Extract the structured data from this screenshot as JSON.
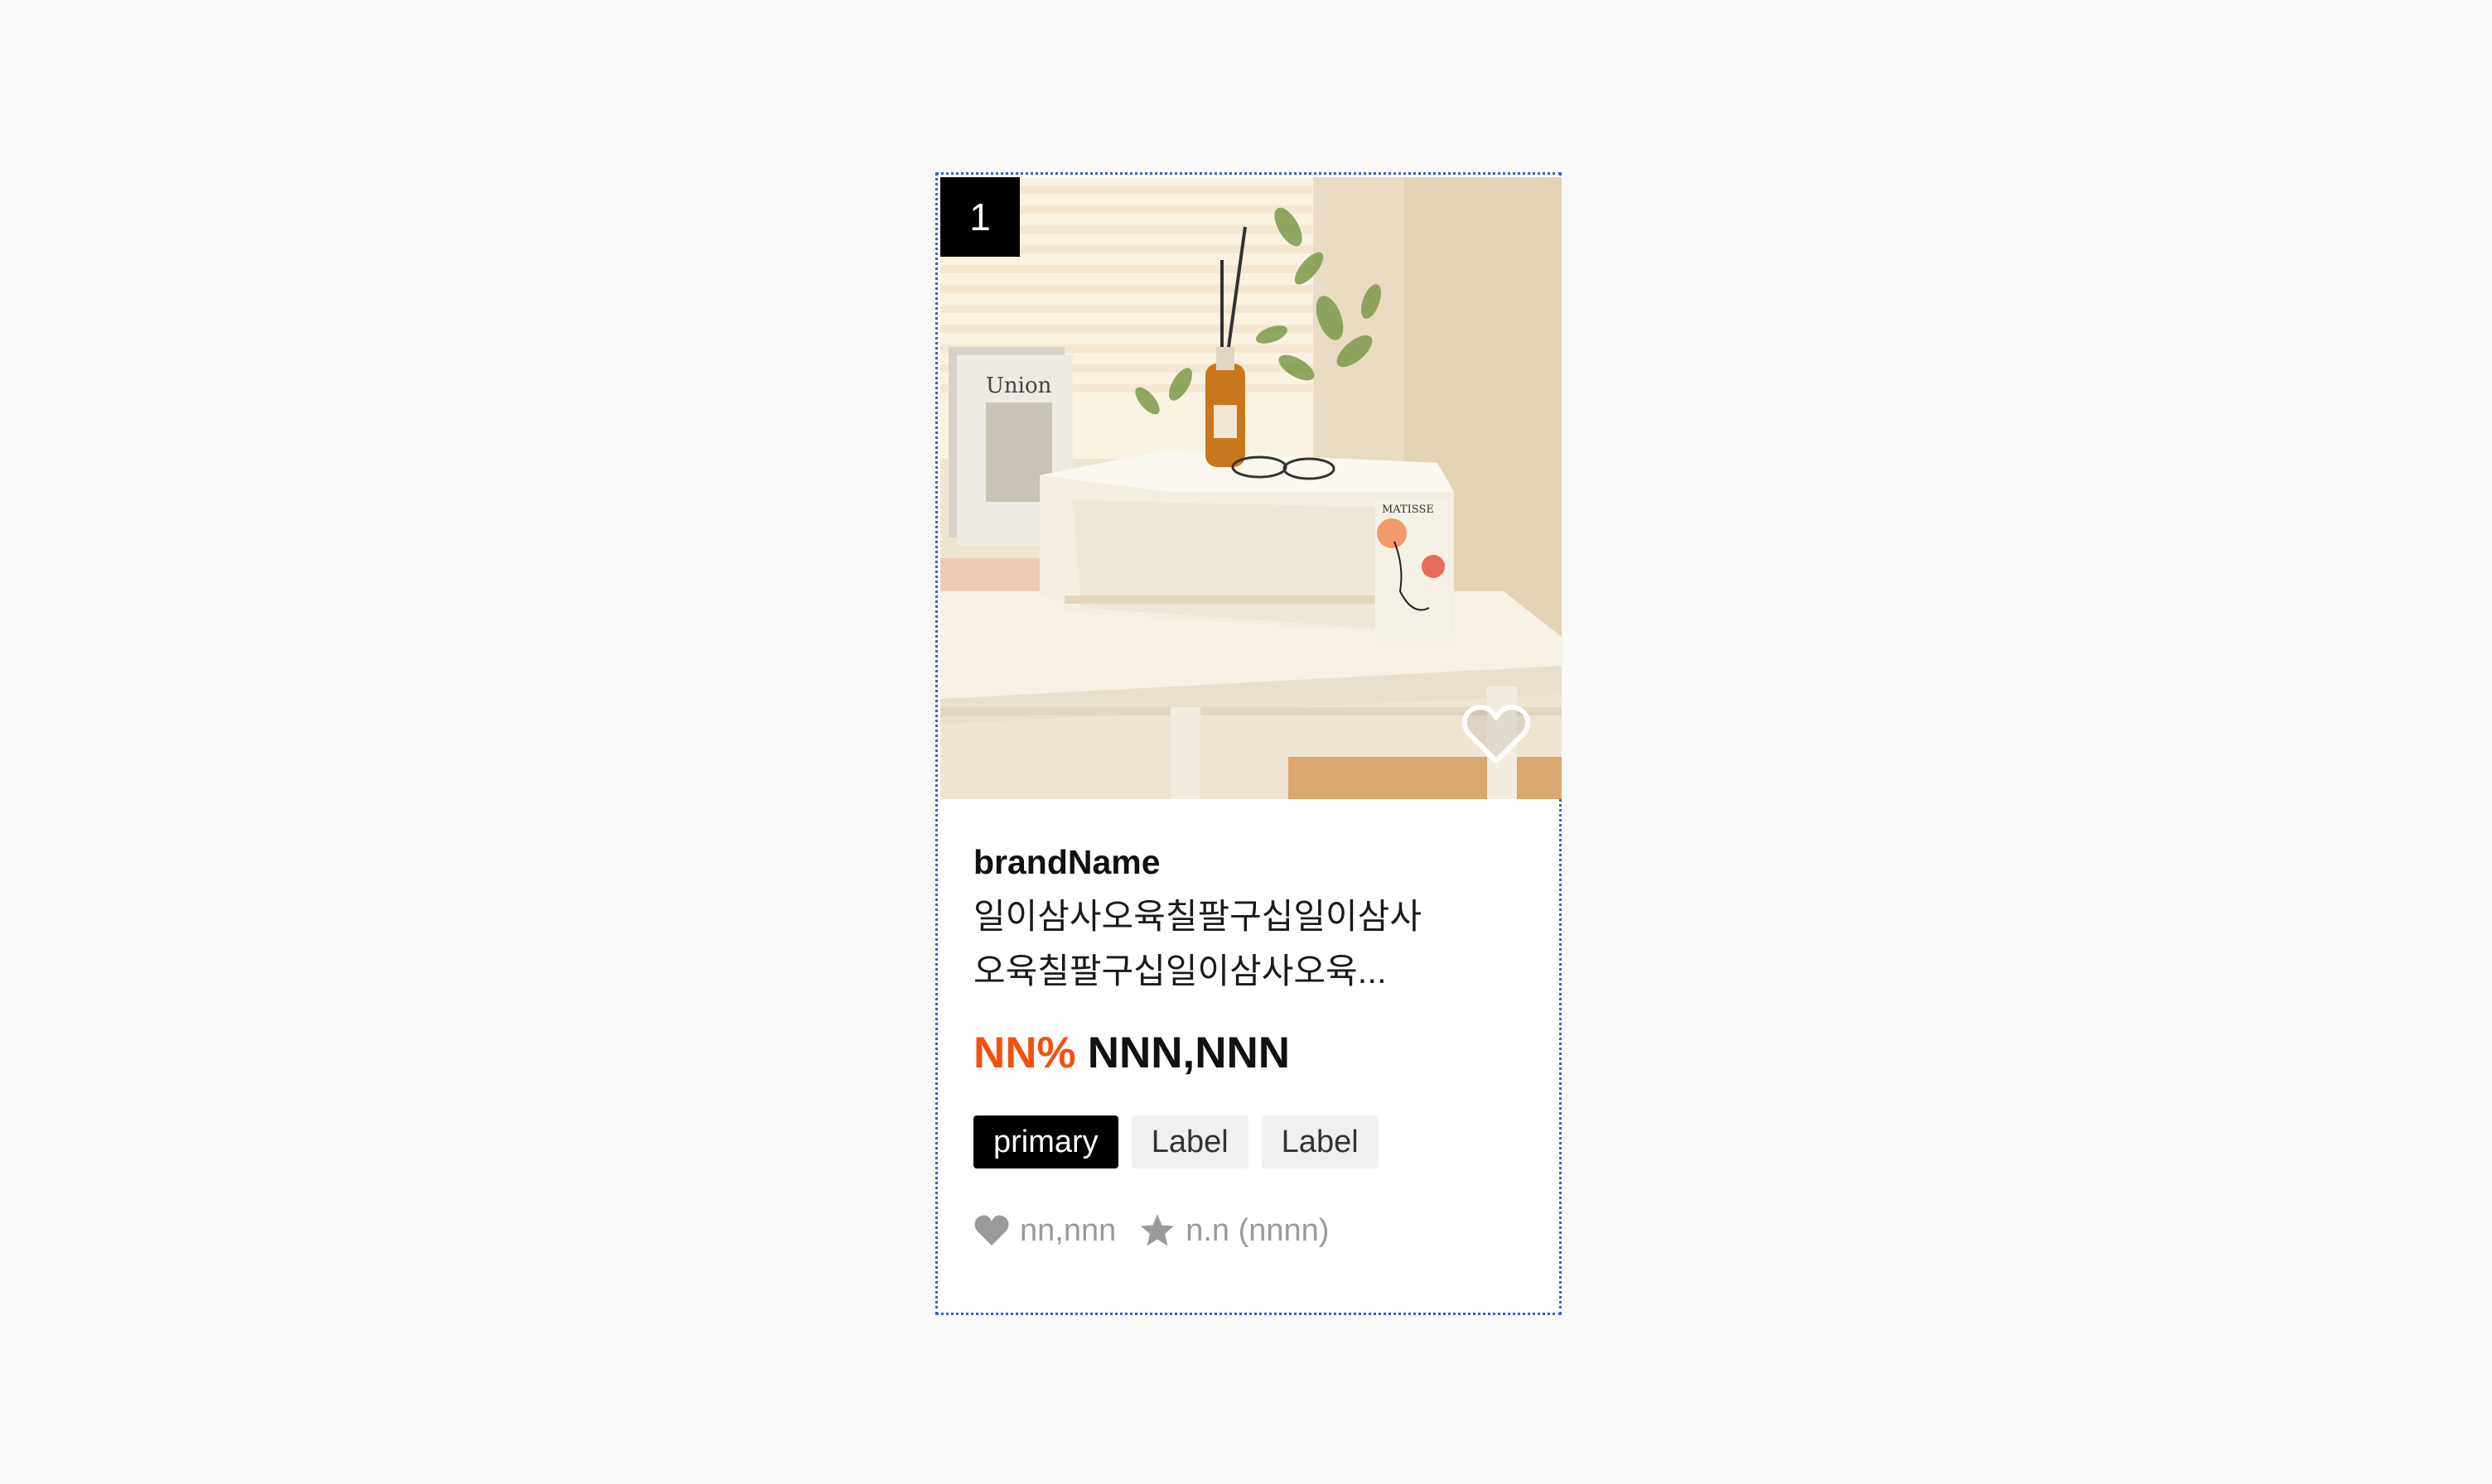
{
  "card": {
    "rank": "1",
    "brand": "brandName",
    "title_line1": "일이삼사오육칠팔구십일이삼사",
    "title_line2": "오육칠팔구십일이삼사오육...",
    "discount_rate": "NN%",
    "price": "NNN,NNN",
    "labels": {
      "primary": "primary",
      "label_1": "Label",
      "label_2": "Label"
    },
    "likes": "nn,nnn",
    "rating": "n.n (nnnn)"
  },
  "image": {
    "book_text": "Union",
    "poster_text": "MATISSE"
  },
  "icons": {
    "wish": "heart-outline-icon",
    "likes": "heart-filled-icon",
    "rating": "star-filled-icon"
  },
  "colors": {
    "selection_border": "#3b5bdb",
    "discount": "#f2510f",
    "label_primary_bg": "#000000",
    "label_bg": "#f0f0f0",
    "meta_text": "#9a9a9a"
  }
}
